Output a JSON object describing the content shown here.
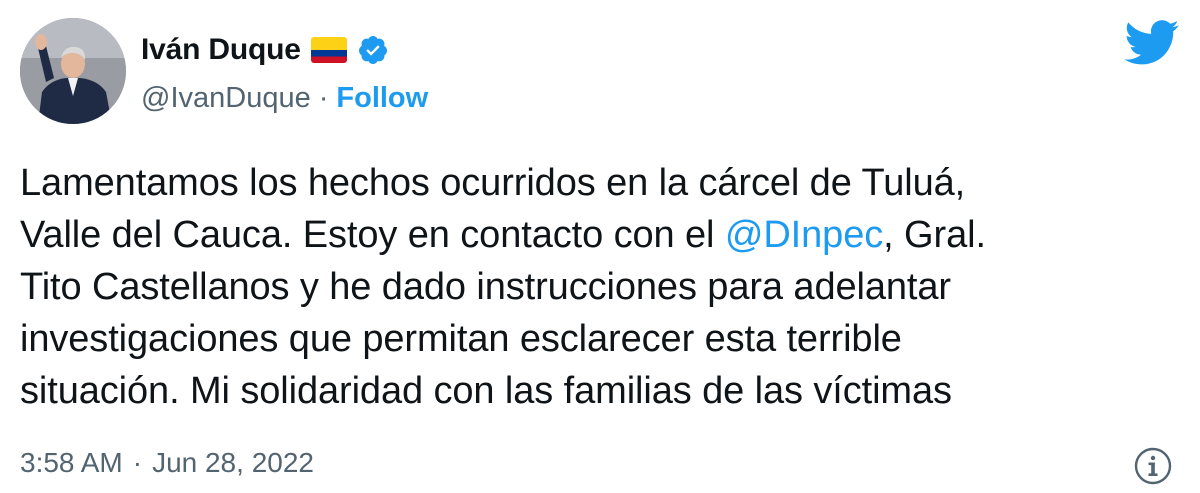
{
  "user": {
    "name": "Iván Duque",
    "handle": "@IvanDuque",
    "separator": "·",
    "follow_label": "Follow",
    "flag_icon": "colombia-flag-icon",
    "verified_icon": "verified-badge-icon"
  },
  "brand": {
    "icon": "twitter-bird-icon",
    "color": "#1d9bf0"
  },
  "tweet": {
    "line1": "Lamentamos los hechos ocurridos en la cárcel de Tuluá,",
    "line2_before": "Valle del Cauca. Estoy en contacto con el ",
    "line2_mention": "@DInpec",
    "line2_after": ", Gral.",
    "line3": "Tito Castellanos y he dado instrucciones para adelantar",
    "line4": "investigaciones que permitan esclarecer esta terrible",
    "line5": "situación. Mi solidaridad con las familias de las víctimas"
  },
  "footer": {
    "time": "3:58 AM",
    "separator": "·",
    "date": "Jun 28, 2022",
    "info_icon": "info-icon"
  },
  "colors": {
    "text": "#0f1419",
    "muted": "#536471",
    "accent": "#1d9bf0",
    "flag_yellow": "#fcd116",
    "flag_blue": "#003893",
    "flag_red": "#ce1126"
  }
}
